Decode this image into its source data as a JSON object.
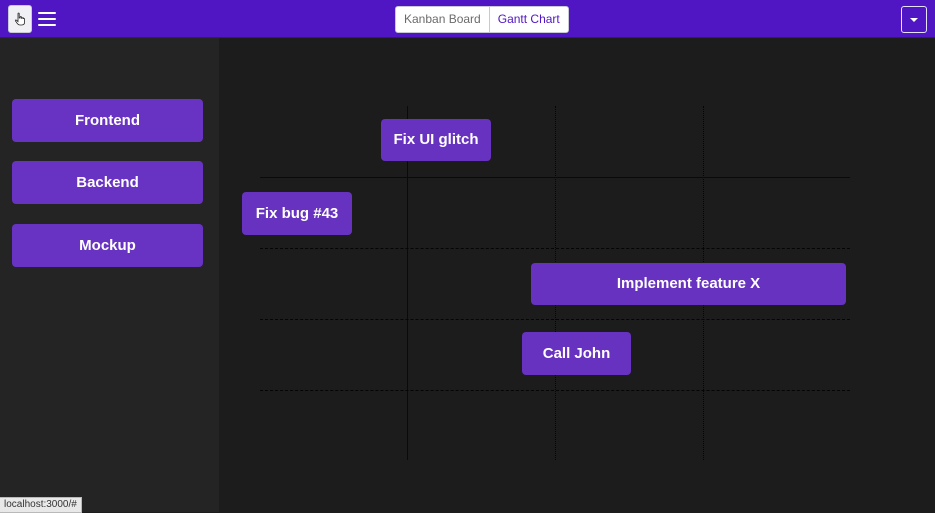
{
  "header": {
    "cursor_icon": "hand-pointer-icon",
    "menu_icon": "hamburger-menu-icon",
    "tabs": [
      {
        "label": "Kanban Board",
        "active": false
      },
      {
        "label": "Gantt Chart",
        "active": true
      }
    ],
    "dropdown_icon": "caret-down-icon",
    "accent_color": "#5116c4"
  },
  "sidebar": {
    "items": [
      {
        "label": "Frontend"
      },
      {
        "label": "Backend"
      },
      {
        "label": "Mockup"
      }
    ]
  },
  "gantt": {
    "tasks": [
      {
        "label": "Fix UI glitch"
      },
      {
        "label": "Fix bug #43"
      },
      {
        "label": "Implement feature X"
      },
      {
        "label": "Call John"
      }
    ],
    "task_color": "#6732bf"
  },
  "status_bar": {
    "url": "localhost:3000/#"
  }
}
